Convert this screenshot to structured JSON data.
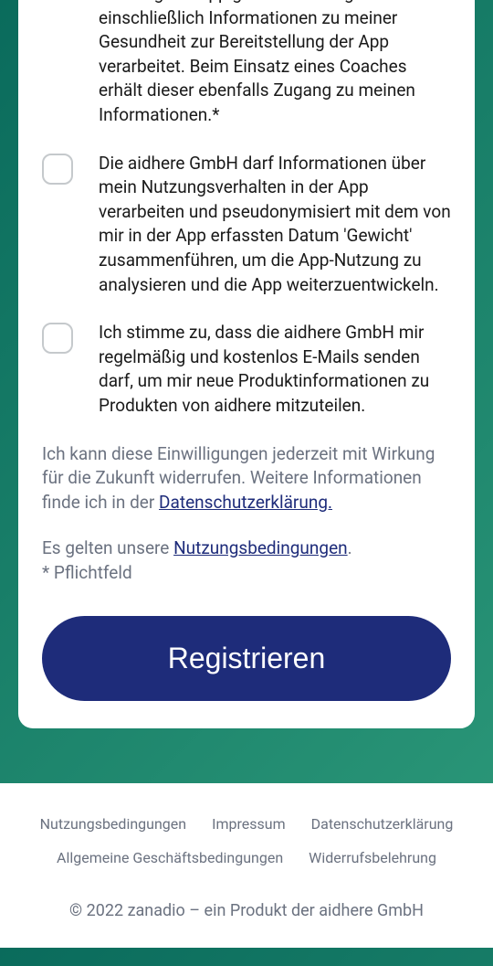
{
  "consents": {
    "consent1_partial": "Nutzung der App gemachten Angaben einschließlich Informationen zu meiner Gesundheit zur Bereitstellung der App verarbeitet. Beim Einsatz eines Coaches erhält dieser ebenfalls Zugang zu meinen Informationen.*",
    "consent2": "Die aidhere GmbH darf Informationen über mein Nutzungsverhalten in der App verarbeiten und pseudonymisiert mit dem von mir in der App erfassten Datum 'Gewicht' zusammenführen, um die App-Nutzung zu analysieren und die App weiterzuentwickeln.",
    "consent3": "Ich stimme zu, dass die aidhere GmbH mir regelmäßig und kostenlos E-Mails senden darf, um mir neue Produktinformationen zu Produkten von aidhere mitzuteilen."
  },
  "info": {
    "withdraw_prefix": "Ich kann diese Einwilligungen jederzeit mit Wirkung für die Zukunft widerrufen. Weitere Informationen finde ich in der ",
    "privacy_link": "Datenschutzerklärung.",
    "terms_prefix": "Es gelten unsere ",
    "terms_link": "Nutzungsbedingungen",
    "terms_suffix": ".",
    "required_field": "* Pflichtfeld"
  },
  "register_button": "Registrieren",
  "footer": {
    "links": {
      "terms": "Nutzungsbedingungen",
      "imprint": "Impressum",
      "privacy": "Datenschutzerklärung",
      "agb": "Allgemeine Geschäftsbedingungen",
      "withdrawal": "Widerrufsbelehrung"
    },
    "copyright": "© 2022 zanadio – ein Produkt der aidhere GmbH"
  }
}
